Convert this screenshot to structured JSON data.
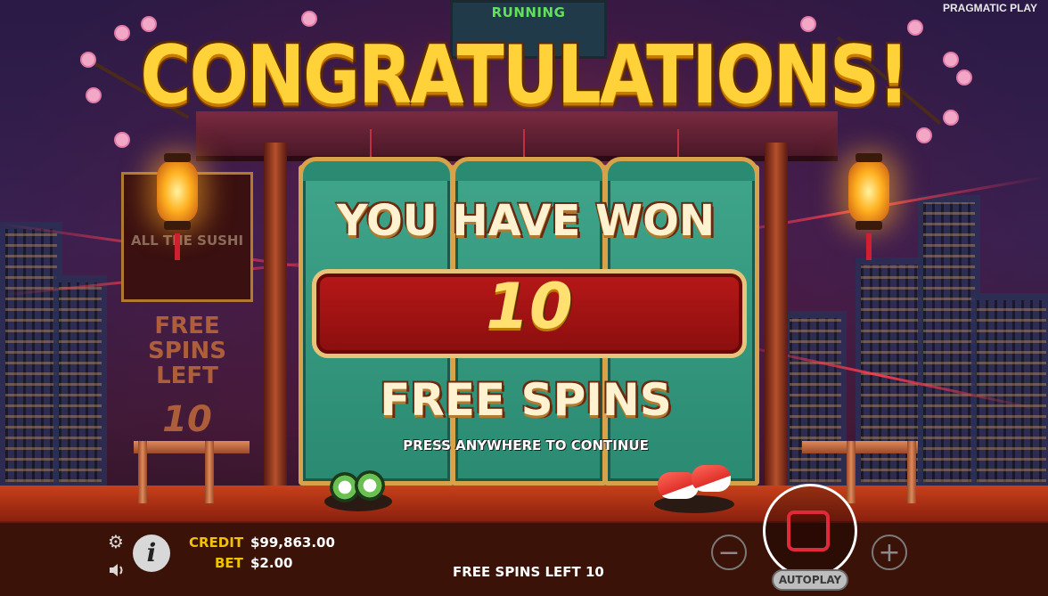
{
  "header": {
    "game_title": "RUNNING",
    "provider": "PRAGMATIC PLAY"
  },
  "popup": {
    "headline": "CONGRATULATIONS!",
    "you_have_won": "YOU HAVE WON",
    "amount": "10",
    "prize_label": "FREE SPINS",
    "continue_hint": "PRESS ANYWHERE TO CONTINUE"
  },
  "background_signs": {
    "sign_text": "ALL THE SUSHI",
    "free_spins_left_label": "FREE SPINS LEFT",
    "free_spins_left_value": "10"
  },
  "hud": {
    "credit_label": "CREDIT",
    "credit_value": "$99,863.00",
    "bet_label": "BET",
    "bet_value": "$2.00",
    "status": "FREE SPINS LEFT 10",
    "autoplay_label": "AUTOPLAY",
    "minus_symbol": "−",
    "plus_symbol": "+",
    "info_symbol": "i",
    "settings_icon": "gear-icon",
    "sound_icon": "speaker-icon",
    "spin_icon": "stop-square-icon"
  },
  "colors": {
    "gold": "#ffd23a",
    "hud_label": "#f2c200",
    "panel_teal": "#3fa58a",
    "plaque_red": "#b71818",
    "stop_red": "#e02a3a"
  }
}
